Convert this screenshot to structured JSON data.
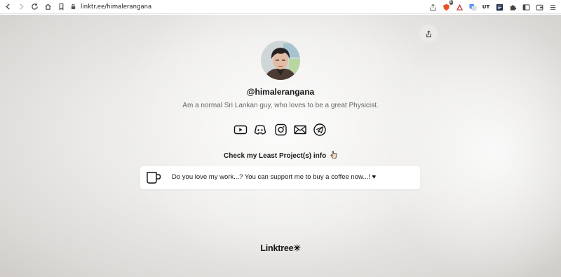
{
  "browser": {
    "url": "linktr.ee/himalerangana",
    "nav_icons": [
      "back-icon",
      "forward-icon",
      "reload-icon",
      "home-icon",
      "bookmark-icon"
    ],
    "extension_icons": [
      "share-page-icon",
      "brave-shield-icon",
      "brave-rewards-icon",
      "translate-icon",
      "ut-extension-icon",
      "checklist-extension-icon",
      "puzzle-extensions-icon",
      "sidebar-icon",
      "wallet-icon",
      "menu-icon"
    ],
    "extensions": {
      "ut_label": "UT",
      "brave_badge": "6"
    }
  },
  "profile": {
    "username": "@himalerangana",
    "bio": "Am a normal Sri Lankan guy, who loves to be a great Physicist.",
    "social_icons": [
      "youtube-icon",
      "discord-icon",
      "instagram-icon",
      "email-icon",
      "telegram-icon"
    ]
  },
  "section": {
    "header": "Check my Least Project(s) info"
  },
  "links": [
    {
      "label": "Do you love my work...? You can support me to buy a coffee now...! ♥",
      "icon": "coffee-cup-icon"
    }
  ],
  "footer": {
    "logo": "Linktree✳"
  },
  "colors": {
    "page_bg": "#ecebe9",
    "card_bg": "#ffffff",
    "text_primary": "#151515",
    "text_secondary": "#676767"
  }
}
